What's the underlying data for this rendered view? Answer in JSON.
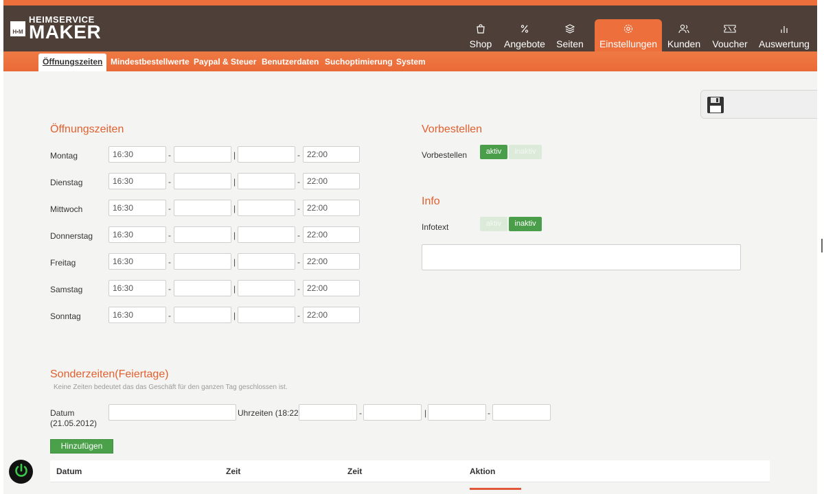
{
  "brand": {
    "top": "HEIMSERVICE",
    "main": "MAKER",
    "mark": "H•M"
  },
  "nav": {
    "items": [
      {
        "label": "Shop",
        "icon": "bag-icon"
      },
      {
        "label": "Angebote",
        "icon": "percent-icon"
      },
      {
        "label": "Seiten",
        "icon": "layers-icon"
      },
      {
        "label": "Einstellungen",
        "icon": "gear-icon",
        "active": true
      },
      {
        "label": "Kunden",
        "icon": "users-icon"
      },
      {
        "label": "Voucher",
        "icon": "ticket-icon"
      },
      {
        "label": "Auswertung",
        "icon": "bar-chart-icon"
      }
    ]
  },
  "subnav": {
    "items": [
      "Öffnungszeiten",
      "Mindestbestellwerte",
      "Paypal & Steuer",
      "Benutzerdaten",
      "Suchoptimierung",
      "System"
    ],
    "active": "Öffnungszeiten"
  },
  "opening": {
    "title": "Öffnungszeiten",
    "days": [
      {
        "label": "Montag",
        "from1": "16:30",
        "to1": "",
        "from2": "",
        "to2": "22:00"
      },
      {
        "label": "Dienstag",
        "from1": "16:30",
        "to1": "",
        "from2": "",
        "to2": "22:00"
      },
      {
        "label": "Mittwoch",
        "from1": "16:30",
        "to1": "",
        "from2": "",
        "to2": "22:00"
      },
      {
        "label": "Donnerstag",
        "from1": "16:30",
        "to1": "",
        "from2": "",
        "to2": "22:00"
      },
      {
        "label": "Freitag",
        "from1": "16:30",
        "to1": "",
        "from2": "",
        "to2": "22:00"
      },
      {
        "label": "Samstag",
        "from1": "16:30",
        "to1": "",
        "from2": "",
        "to2": "22:00"
      },
      {
        "label": "Sonntag",
        "from1": "16:30",
        "to1": "",
        "from2": "",
        "to2": "22:00"
      }
    ]
  },
  "preorder": {
    "title": "Vorbestellen",
    "label": "Vorbestellen",
    "on": "aktiv",
    "off": "inaktiv",
    "state": "aktiv"
  },
  "info": {
    "title": "Info",
    "label": "Infotext",
    "on": "aktiv",
    "off": "inaktiv",
    "state": "inaktiv",
    "text": ""
  },
  "special": {
    "title": "Sonderzeiten(Feiertage)",
    "hint": "Keine Zeiten bedeutet das das Geschäft für den ganzen Tag geschlossen ist.",
    "date_label": "Datum",
    "date_hint": "(21.05.2012)",
    "time_label": "Uhrzeiten (18:22)",
    "add_button": "Hinzufügen",
    "table_headers": [
      "Datum",
      "Zeit",
      "Zeit",
      "Aktion"
    ]
  },
  "separators": {
    "dash": "-",
    "bar": "|"
  },
  "colors": {
    "header": "#4e4038",
    "accent": "#ec6f3c",
    "title": "#e0602f",
    "green": "#4a9e4a"
  }
}
